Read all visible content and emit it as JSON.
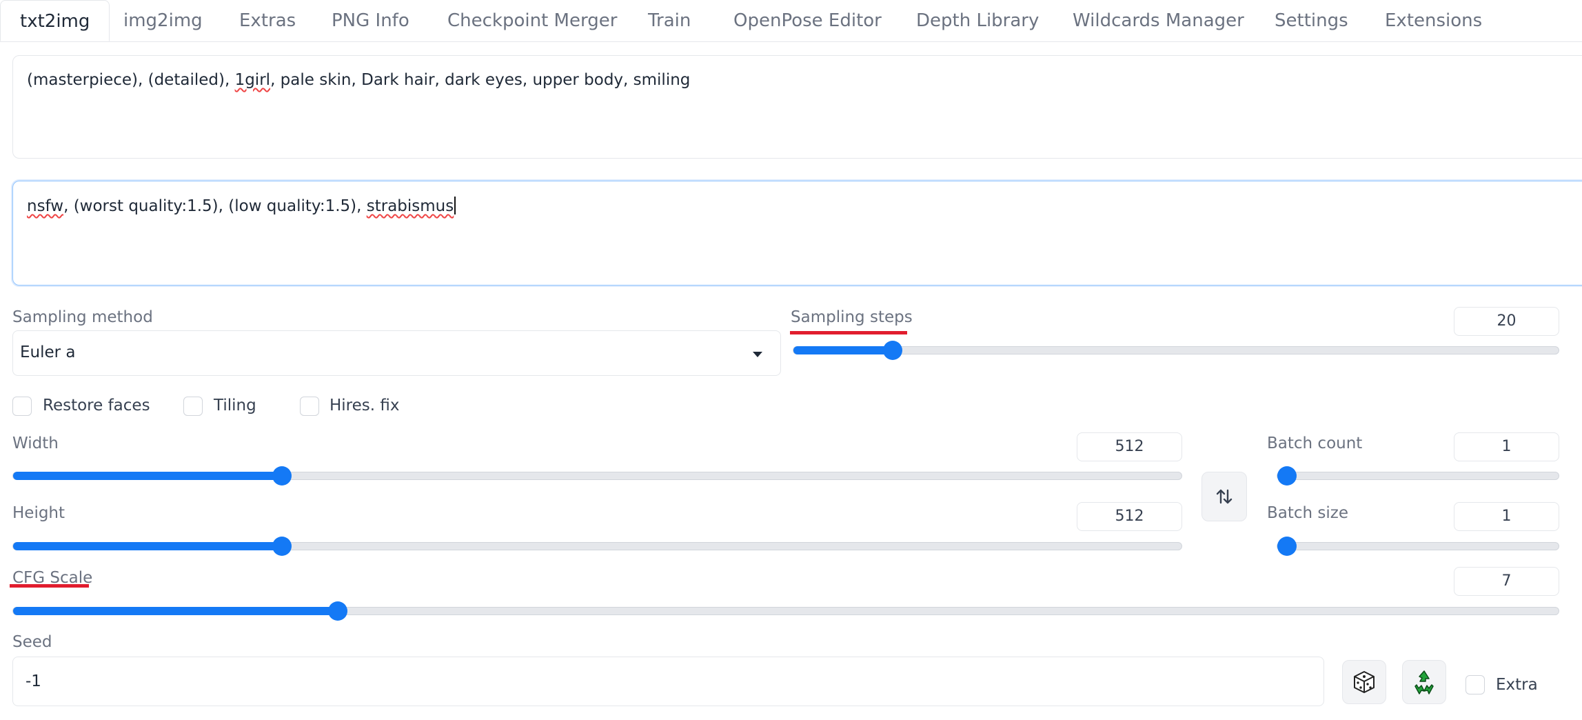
{
  "tabs": [
    {
      "label": "txt2img",
      "active": true
    },
    {
      "label": "img2img"
    },
    {
      "label": "Extras"
    },
    {
      "label": "PNG Info"
    },
    {
      "label": "Checkpoint Merger"
    },
    {
      "label": "Train"
    },
    {
      "label": "OpenPose Editor"
    },
    {
      "label": "Depth Library"
    },
    {
      "label": "Wildcards Manager"
    },
    {
      "label": "Settings"
    },
    {
      "label": "Extensions"
    }
  ],
  "prompt": {
    "p1": "(masterpiece), (detailed), ",
    "w1": "1girl",
    "p2": ", pale skin, Dark hair, dark eyes, upper body, smiling"
  },
  "negative_prompt": {
    "w1": "nsfw",
    "p1": ", (worst quality:1.5), (low quality:1.5), ",
    "w2": "strabismus"
  },
  "sampling_method": {
    "label": "Sampling method",
    "value": "Euler a"
  },
  "sampling_steps": {
    "label": "Sampling steps",
    "value": "20",
    "fraction": 0.13
  },
  "checkboxes": {
    "restore_faces": "Restore faces",
    "tiling": "Tiling",
    "hires_fix": "Hires. fix"
  },
  "width": {
    "label": "Width",
    "value": "512",
    "fraction": 0.23
  },
  "height": {
    "label": "Height",
    "value": "512",
    "fraction": 0.23
  },
  "batch_count": {
    "label": "Batch count",
    "value": "1",
    "fraction": 0.0
  },
  "batch_size": {
    "label": "Batch size",
    "value": "1",
    "fraction": 0.0
  },
  "cfg_scale": {
    "label": "CFG Scale",
    "value": "7",
    "fraction": 0.21
  },
  "seed": {
    "label": "Seed",
    "value": "-1"
  },
  "extra": {
    "label": "Extra"
  },
  "icons": {
    "swap": "swap-dimensions-icon",
    "dice": "dice-icon",
    "recycle": "recycle-icon"
  },
  "colors": {
    "accent": "#1479f5",
    "annotation": "#e11d2e",
    "focus_border": "#93c5fd"
  }
}
